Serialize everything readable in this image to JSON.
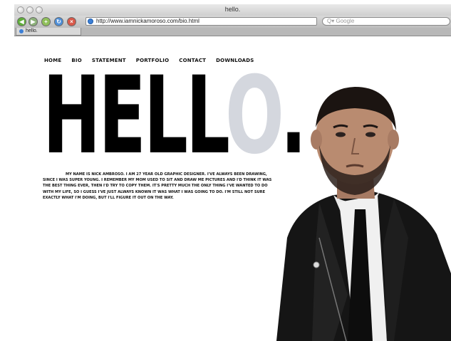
{
  "window": {
    "title": "hello."
  },
  "toolbar": {
    "url": "http://www.iamnickamoroso.com/bio.html",
    "search_placeholder": "Google",
    "icons": [
      "back-icon",
      "forward-icon",
      "add-bookmark-icon",
      "reload-icon",
      "stop-icon"
    ]
  },
  "tab": {
    "label": "hello."
  },
  "nav": [
    "HOME",
    "BIO",
    "STATEMENT",
    "PORTFOLIO",
    "CONTACT",
    "DOWNLOADS"
  ],
  "hero": {
    "text_dark": "HELL",
    "text_light": "O",
    "dot": "."
  },
  "bio": "MY NAME IS NICK AMBROSO. I AM 27 YEAR OLD GRAPHIC DESIGNER. I'VE ALWAYS BEEN DRAWING, SINCE I WAS SUPER YOUNG. I REMEMBER MY MOM USED TO SIT AND DRAW ME PICTURES AND I'D THINK IT WAS THE BEST THING EVER, THEN I'D TRY TO COPY THEM. IT'S PRETTY MUCH THE ONLY THING I'VE WANTED TO DO WITH MY LIFE, SO I GUESS I'VE JUST ALWAYS KNOWN IT WAS WHAT I WAS GOING TO DO. I'M STILL NOT SURE EXACTLY WHAT I'M DOING, BUT I'LL FIGURE IT OUT ON THE WAY.",
  "colors": {
    "o_letter": "#d4d7de",
    "text": "#000000"
  }
}
